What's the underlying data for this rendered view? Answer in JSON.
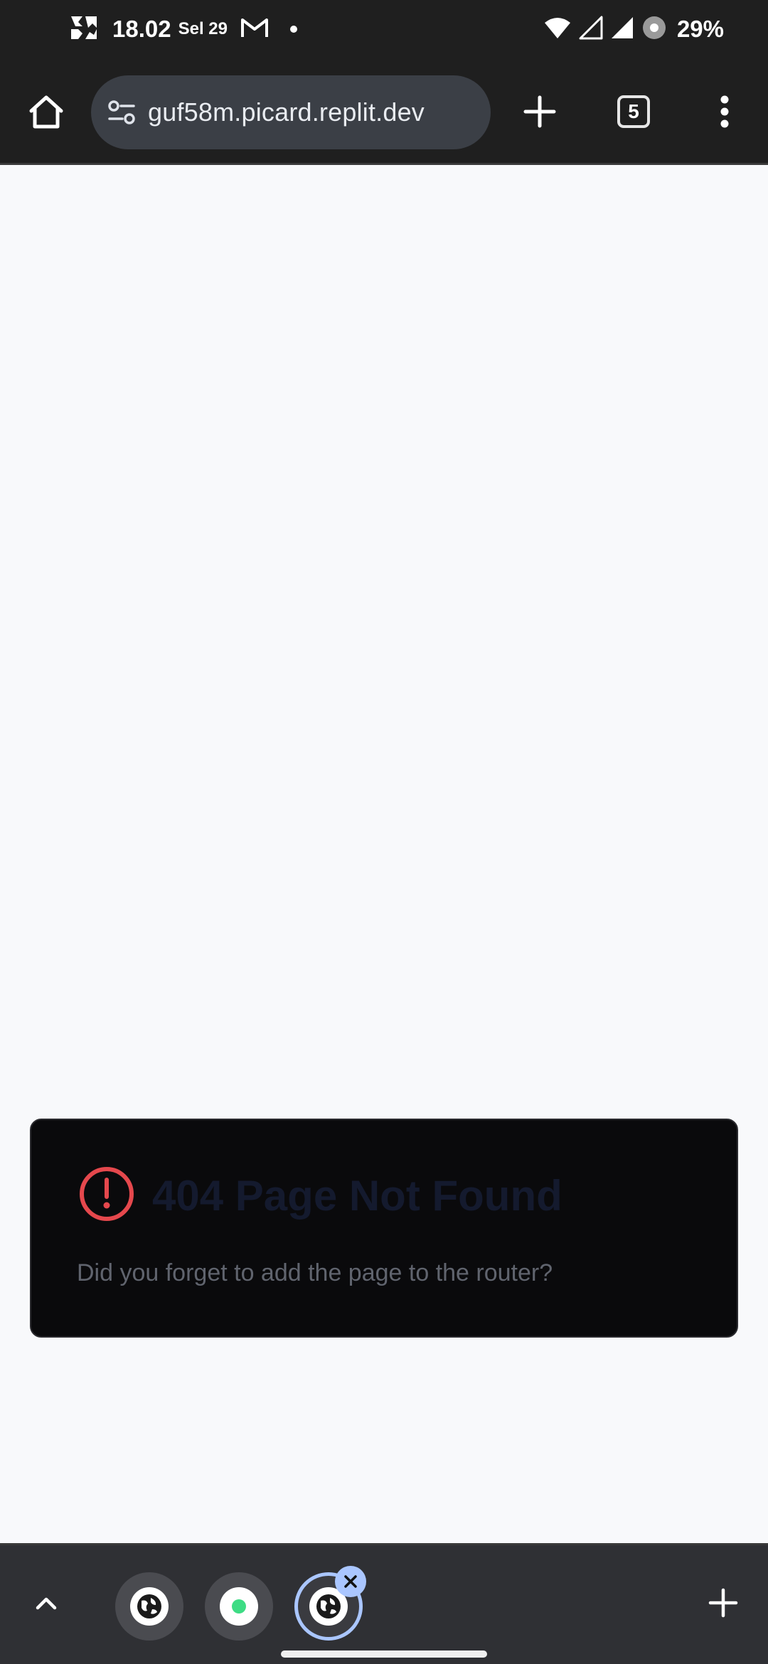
{
  "status_bar": {
    "time": "18.02",
    "date": "Sel 29",
    "battery": "29%",
    "icons": [
      "app-notification-icon",
      "gmail-icon",
      "wifi-icon",
      "signal-icon",
      "signal-icon",
      "battery-saver-icon"
    ]
  },
  "toolbar": {
    "url": "guf58m.picard.replit.dev",
    "tab_count": "5",
    "icons": [
      "home-icon",
      "site-settings-icon",
      "plus-icon",
      "tab-switcher-icon",
      "more-vert-icon"
    ]
  },
  "error_card": {
    "title": "404 Page Not Found",
    "message": "Did you forget to add the page to the router?",
    "icon_color": "#e5484d"
  },
  "tab_strip": {
    "icons": [
      "chevron-up-icon",
      "globe-icon",
      "green-dot-icon",
      "globe-icon",
      "close-icon",
      "plus-icon"
    ],
    "accent": "#aac6ff"
  }
}
